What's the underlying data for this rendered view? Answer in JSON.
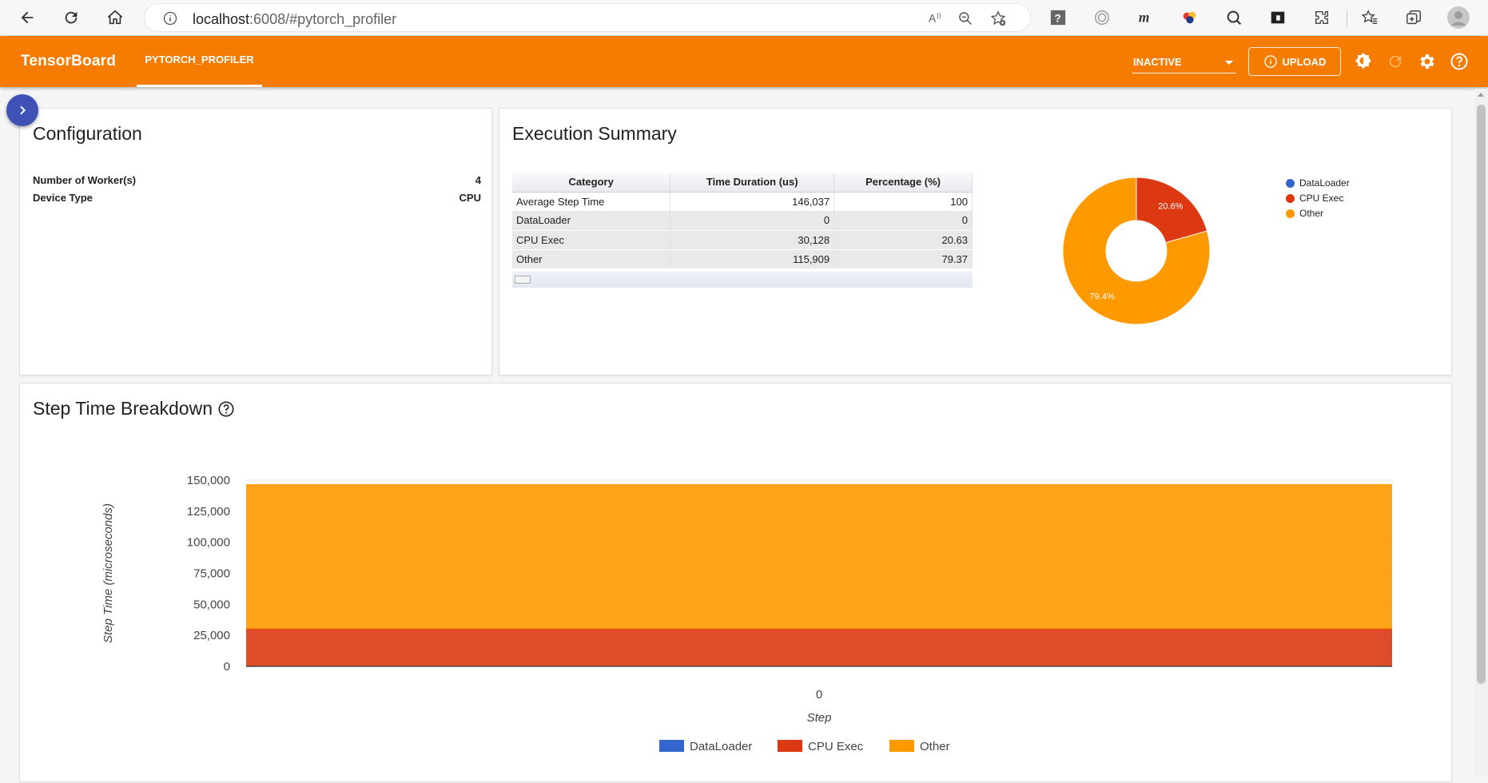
{
  "browser": {
    "url_host": "localhost",
    "url_rest": ":6008/#pytorch_profiler"
  },
  "header": {
    "brand": "TensorBoard",
    "active_tab": "PYTORCH_PROFILER",
    "run_select": "INACTIVE",
    "upload_label": "UPLOAD"
  },
  "configuration": {
    "title": "Configuration",
    "rows": [
      {
        "label": "Number of Worker(s)",
        "value": "4"
      },
      {
        "label": "Device Type",
        "value": "CPU"
      }
    ]
  },
  "execution_summary": {
    "title": "Execution Summary",
    "columns": [
      "Category",
      "Time Duration (us)",
      "Percentage (%)"
    ],
    "rows": [
      [
        "Average Step Time",
        "146,037",
        "100"
      ],
      [
        "DataLoader",
        "0",
        "0"
      ],
      [
        "CPU Exec",
        "30,128",
        "20.63"
      ],
      [
        "Other",
        "115,909",
        "79.37"
      ]
    ],
    "pie_labels": [
      "20.6%",
      "79.4%"
    ],
    "legend": [
      "DataLoader",
      "CPU Exec",
      "Other"
    ]
  },
  "step_breakdown": {
    "title": "Step Time Breakdown"
  },
  "colors": {
    "accent": "#f57c00",
    "dataloader": "#3366cc",
    "cpu_exec": "#dc3912",
    "other": "#ff9900"
  },
  "chart_data": [
    {
      "type": "pie",
      "categories": [
        "DataLoader",
        "CPU Exec",
        "Other"
      ],
      "values": [
        0,
        30128,
        115909
      ],
      "labels": [
        "",
        "20.6%",
        "79.4%"
      ],
      "donut": true,
      "legend": "right"
    },
    {
      "type": "area",
      "title": "Step Time Breakdown",
      "xlabel": "Step",
      "ylabel": "Step Time (microseconds)",
      "x": [
        0
      ],
      "ylim": [
        0,
        150000
      ],
      "yticks": [
        "0",
        "25,000",
        "50,000",
        "75,000",
        "100,000",
        "125,000",
        "150,000"
      ],
      "xticks": [
        "0"
      ],
      "stacked": true,
      "series": [
        {
          "name": "DataLoader",
          "values": [
            0
          ]
        },
        {
          "name": "CPU Exec",
          "values": [
            30128
          ]
        },
        {
          "name": "Other",
          "values": [
            115909
          ]
        }
      ],
      "legend": "bottom"
    }
  ]
}
